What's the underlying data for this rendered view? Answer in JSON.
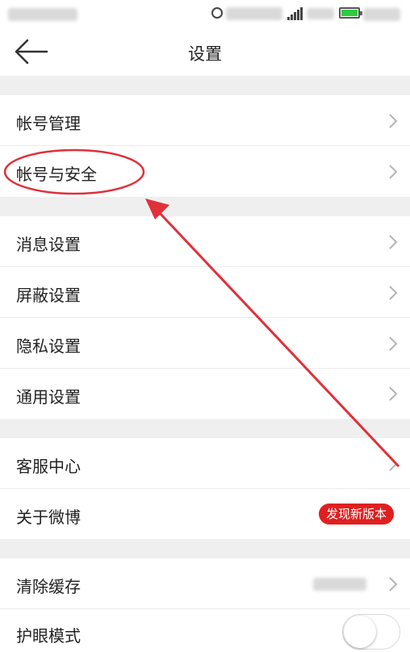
{
  "nav": {
    "title": "设置"
  },
  "groups": [
    {
      "items": [
        {
          "label": "帐号管理"
        },
        {
          "label": "帐号与安全"
        }
      ]
    },
    {
      "items": [
        {
          "label": "消息设置"
        },
        {
          "label": "屏蔽设置"
        },
        {
          "label": "隐私设置"
        },
        {
          "label": "通用设置"
        }
      ]
    },
    {
      "items": [
        {
          "label": "客服中心"
        },
        {
          "label": "关于微博",
          "badge": "发现新版本"
        }
      ]
    },
    {
      "items": [
        {
          "label": "清除缓存"
        },
        {
          "label": "护眼模式",
          "toggle": false
        }
      ]
    }
  ],
  "colors": {
    "annotation": "#e0303a",
    "badge": "#e02020",
    "group_gap": "#efefef"
  },
  "icons": {
    "back": "arrow-left-icon",
    "chevron": "chevron-right-icon"
  }
}
